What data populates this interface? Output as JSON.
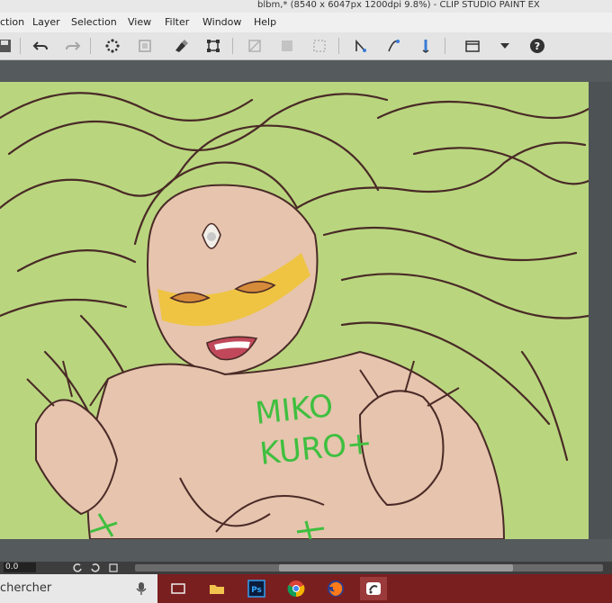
{
  "window": {
    "title": "blbm,* (8540 x 6047px 1200dpi 9.8%)  - CLIP STUDIO PAINT EX"
  },
  "menu": {
    "items": [
      {
        "label": "ction"
      },
      {
        "label": "Layer"
      },
      {
        "label": "Selection"
      },
      {
        "label": "View"
      },
      {
        "label": "Filter"
      },
      {
        "label": "Window"
      },
      {
        "label": "Help"
      }
    ]
  },
  "toolbar": {
    "icons": [
      "save-icon",
      "undo-icon",
      "redo-icon",
      "loading-icon",
      "transform-icon",
      "clear-icon",
      "crop-icon",
      "disabled-fill-icon",
      "disabled-fill-2-icon",
      "selection-icon",
      "pen-correction-icon",
      "pen-correction-2-icon",
      "pen-correction-3-icon",
      "settings-icon",
      "dropdown-icon",
      "help-icon"
    ]
  },
  "canvas": {
    "background_color": "#b9d67f",
    "line_color": "#4a2a26",
    "skin_color": "#e6c4ae",
    "mask_color": "#f0c437",
    "signature_color": "#3fbf3f",
    "signature_line1": "MIKO",
    "signature_line2": "KURO+"
  },
  "statusbar": {
    "zoom": "0.0"
  },
  "taskbar": {
    "search_text": "chercher",
    "apps": [
      "task-view-icon",
      "file-explorer-icon",
      "photoshop-icon",
      "chrome-icon",
      "firefox-icon",
      "clip-studio-icon"
    ],
    "colors": {
      "taskbar": "#7a1f20",
      "active": "#9a3a3a"
    }
  }
}
